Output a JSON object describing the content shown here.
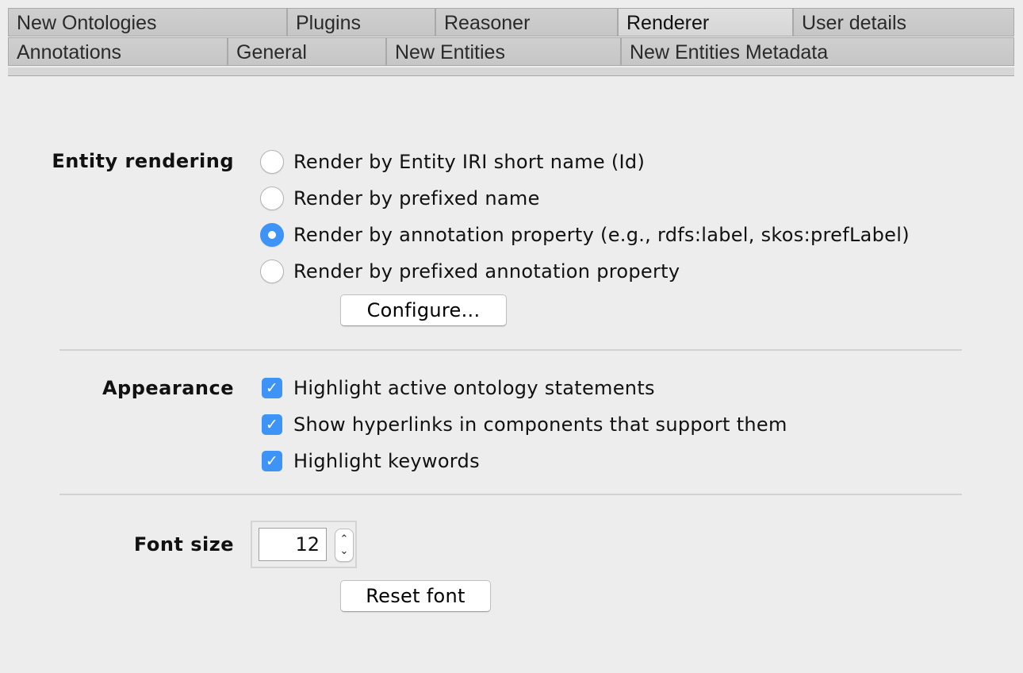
{
  "tabs": {
    "row1": [
      {
        "label": "New Ontologies",
        "active": false
      },
      {
        "label": "Plugins",
        "active": false
      },
      {
        "label": "Reasoner",
        "active": false
      },
      {
        "label": "Renderer",
        "active": true
      },
      {
        "label": "User details",
        "active": false
      }
    ],
    "row2": [
      {
        "label": "Annotations",
        "active": false
      },
      {
        "label": "General",
        "active": false
      },
      {
        "label": "New Entities",
        "active": false
      },
      {
        "label": "New Entities Metadata",
        "active": false
      }
    ]
  },
  "entity_rendering": {
    "label": "Entity rendering",
    "options": [
      {
        "label": "Render by Entity IRI short name (Id)",
        "selected": false
      },
      {
        "label": "Render by prefixed name",
        "selected": false
      },
      {
        "label": "Render by annotation property (e.g., rdfs:label, skos:prefLabel)",
        "selected": true
      },
      {
        "label": "Render by prefixed annotation property",
        "selected": false
      }
    ],
    "configure_button": "Configure..."
  },
  "appearance": {
    "label": "Appearance",
    "options": [
      {
        "label": "Highlight active ontology statements",
        "checked": true
      },
      {
        "label": "Show hyperlinks in components that support them",
        "checked": true
      },
      {
        "label": "Highlight keywords",
        "checked": true
      }
    ],
    "check_glyph": "✓"
  },
  "font": {
    "label": "Font size",
    "value": "12",
    "spinner_up": "⌃",
    "spinner_down": "⌄",
    "reset_button": "Reset font"
  },
  "colors": {
    "accent": "#3d94f6",
    "background": "#ededed",
    "tab_bg": "#c9c9c9",
    "tab_active_bg": "#dcdcdc",
    "separator": "#d2d2d2"
  }
}
